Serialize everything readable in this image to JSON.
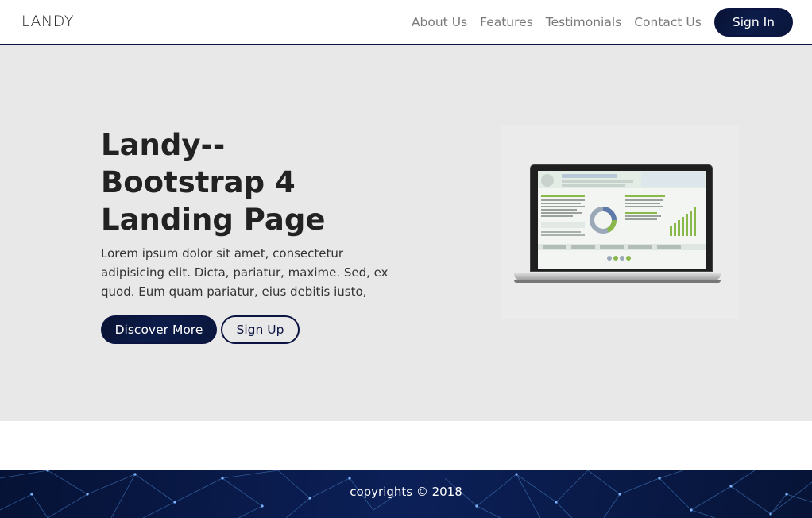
{
  "navbar": {
    "brand": "LANDY",
    "links": [
      "About Us",
      "Features",
      "Testimonials",
      "Contact Us"
    ],
    "signin_label": "Sign In"
  },
  "hero": {
    "title_lines": [
      "Landy--",
      "Bootstrap 4",
      "Landing Page"
    ],
    "text": "Lorem ipsum dolor sit amet, consectetur adipisicing elit. Dicta, pariatur, maxime. Sed, ex quod. Eum quam pariatur, eius debitis iusto,",
    "discover_label": "Discover More",
    "signup_label": "Sign Up",
    "illustration": "laptop-dashboard"
  },
  "footer": {
    "text": "copyrights © 2018"
  },
  "colors": {
    "navy": "#0b1440",
    "hero_bg": "#e8e8e8",
    "link_gray": "#7a7a7a"
  }
}
